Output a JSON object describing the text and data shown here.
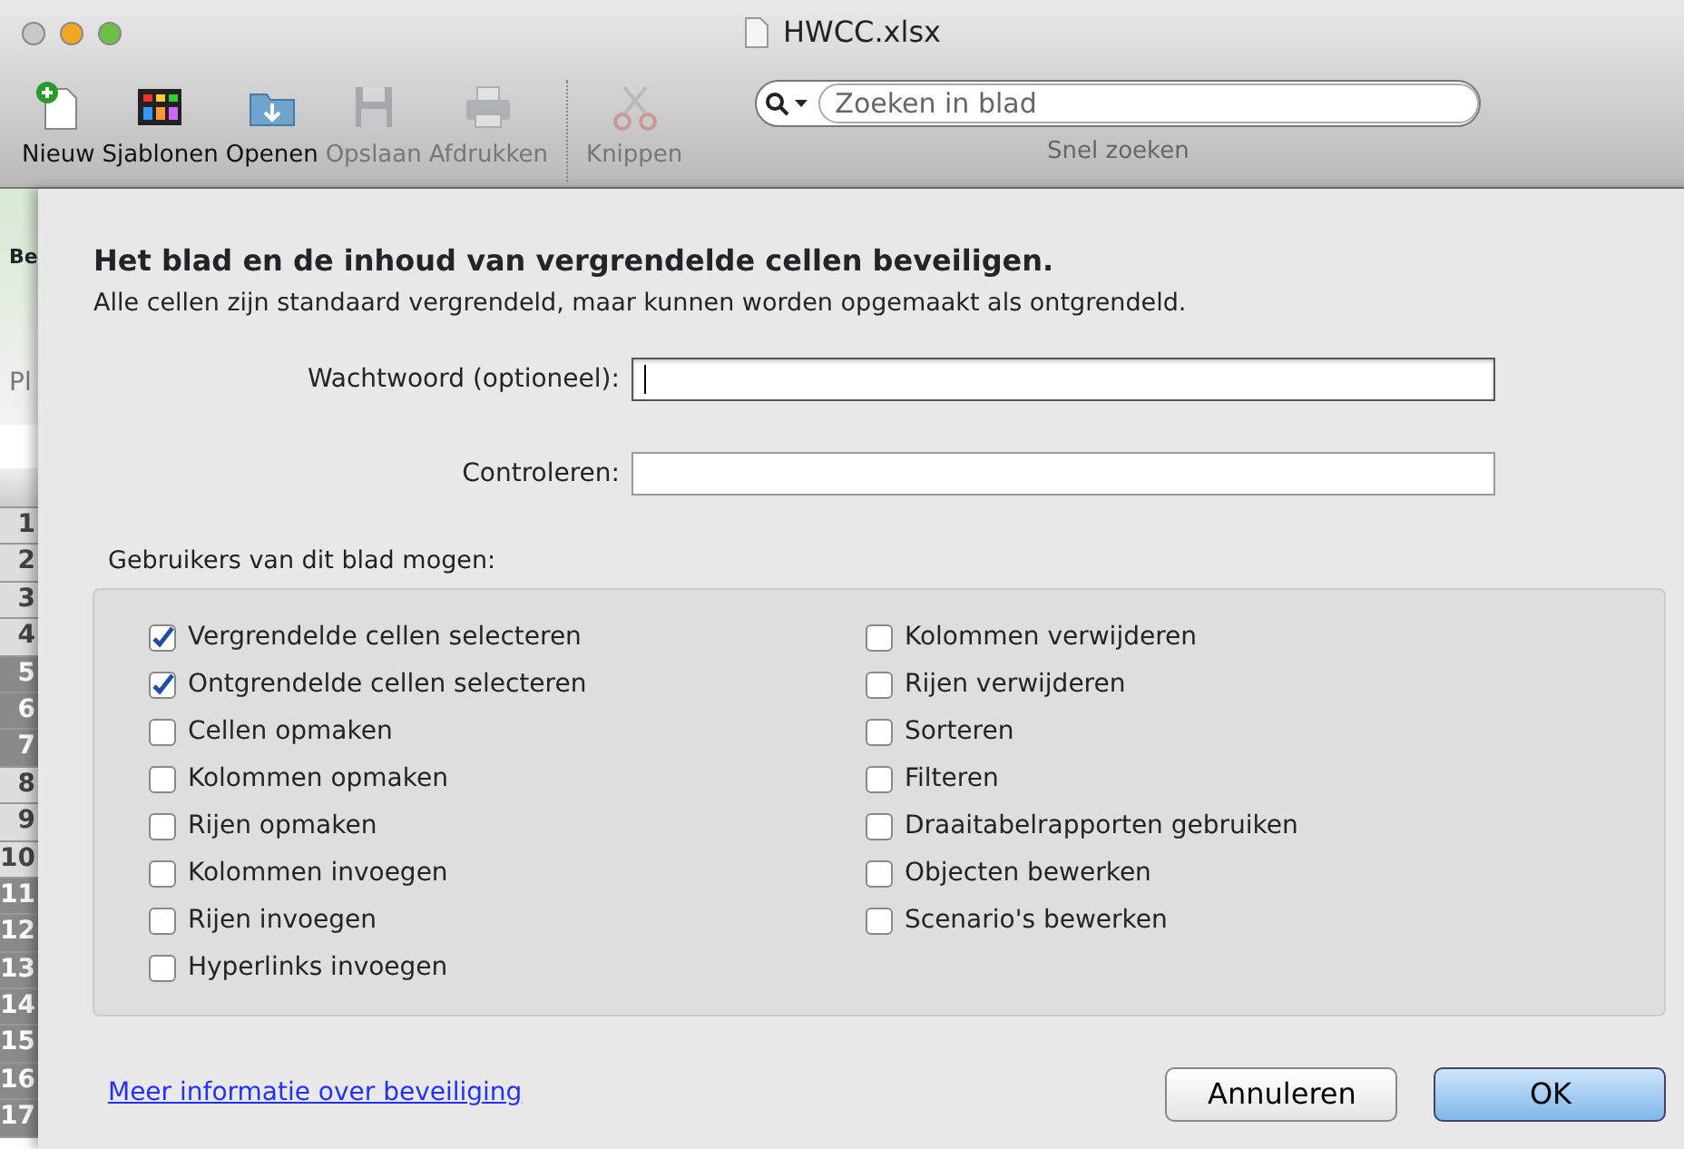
{
  "window": {
    "title": "HWCC.xlsx"
  },
  "toolbar": {
    "items": [
      {
        "label": "Nieuw",
        "disabled": false
      },
      {
        "label": "Sjablonen",
        "disabled": false
      },
      {
        "label": "Openen",
        "disabled": false
      },
      {
        "label": "Opslaan",
        "disabled": true
      },
      {
        "label": "Afdrukken",
        "disabled": true
      },
      {
        "label": "Knippen",
        "disabled": true
      }
    ],
    "search": {
      "placeholder": "Zoeken in blad",
      "caption": "Snel zoeken"
    }
  },
  "sheet": {
    "ribbon_texts": [
      "Be",
      "Pl"
    ],
    "row_headers": [
      {
        "label": "1",
        "selected": false
      },
      {
        "label": "2",
        "selected": false
      },
      {
        "label": "3",
        "selected": false
      },
      {
        "label": "4",
        "selected": false
      },
      {
        "label": "5",
        "selected": true
      },
      {
        "label": "6",
        "selected": true
      },
      {
        "label": "7",
        "selected": true
      },
      {
        "label": "8",
        "selected": false
      },
      {
        "label": "9",
        "selected": false
      },
      {
        "label": "10",
        "selected": false
      },
      {
        "label": "11",
        "selected": true
      },
      {
        "label": "12",
        "selected": true
      },
      {
        "label": "13",
        "selected": true
      },
      {
        "label": "14",
        "selected": true
      },
      {
        "label": "15",
        "selected": true
      },
      {
        "label": "16",
        "selected": true
      },
      {
        "label": "17",
        "selected": true
      }
    ]
  },
  "dialog": {
    "title": "Het blad en de inhoud van vergrendelde cellen beveiligen.",
    "subtitle": "Alle cellen zijn standaard vergrendeld, maar kunnen worden opgemaakt als ontgrendeld.",
    "fields": [
      {
        "label": "Wachtwoord (optioneel):",
        "focused": true
      },
      {
        "label": "Controleren:",
        "focused": false
      }
    ],
    "group_label": "Gebruikers van dit blad mogen:",
    "left_options": [
      {
        "label": "Vergrendelde cellen selecteren",
        "checked": true
      },
      {
        "label": "Ontgrendelde cellen selecteren",
        "checked": true
      },
      {
        "label": "Cellen opmaken",
        "checked": false
      },
      {
        "label": "Kolommen opmaken",
        "checked": false
      },
      {
        "label": "Rijen opmaken",
        "checked": false
      },
      {
        "label": "Kolommen invoegen",
        "checked": false
      },
      {
        "label": "Rijen invoegen",
        "checked": false
      },
      {
        "label": "Hyperlinks invoegen",
        "checked": false
      }
    ],
    "right_options": [
      {
        "label": "Kolommen verwijderen",
        "checked": false
      },
      {
        "label": "Rijen verwijderen",
        "checked": false
      },
      {
        "label": "Sorteren",
        "checked": false
      },
      {
        "label": "Filteren",
        "checked": false
      },
      {
        "label": "Draaitabelrapporten gebruiken",
        "checked": false
      },
      {
        "label": "Objecten bewerken",
        "checked": false
      },
      {
        "label": "Scenario's bewerken",
        "checked": false
      }
    ],
    "link": "Meer informatie over beveiliging",
    "buttons": [
      {
        "label": "Annuleren",
        "default": false
      },
      {
        "label": "OK",
        "default": true
      }
    ]
  }
}
